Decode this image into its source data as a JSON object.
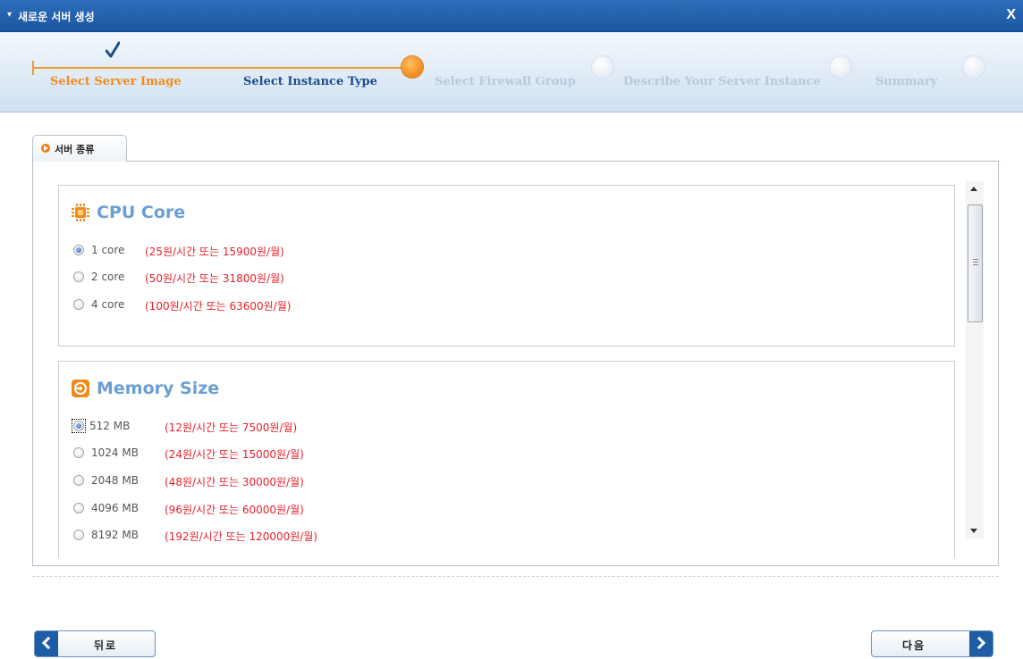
{
  "window": {
    "title": "새로운 서버 생성",
    "close_label": "X",
    "collapse_glyph": "▾"
  },
  "wizard": {
    "steps": [
      {
        "label": "Select Server Image",
        "state": "done"
      },
      {
        "label": "Select Instance Type",
        "state": "current"
      },
      {
        "label": "Select Firewall Group",
        "state": "future"
      },
      {
        "label": "Describe Your Server Instance",
        "state": "future"
      },
      {
        "label": "Summary",
        "state": "future"
      }
    ],
    "colors": {
      "done": "#f28a1a",
      "current": "#1d4e8a",
      "future": "#b8c9dc"
    }
  },
  "tab": {
    "label": "서버 종류"
  },
  "cpu": {
    "title": "CPU Core",
    "icon": "cpu-chip-icon",
    "options": [
      {
        "label": "1 core",
        "price": "(25원/시간 또는 15900원/월)",
        "selected": true
      },
      {
        "label": "2 core",
        "price": "(50원/시간 또는 31800원/월)",
        "selected": false
      },
      {
        "label": "4 core",
        "price": "(100원/시간 또는 63600원/월)",
        "selected": false
      }
    ]
  },
  "memory": {
    "title": "Memory Size",
    "icon": "memory-disk-icon",
    "options": [
      {
        "label": "512 MB",
        "price": "(12원/시간 또는 7500원/월)",
        "selected": true
      },
      {
        "label": "1024 MB",
        "price": "(24원/시간 또는 15000원/월)",
        "selected": false
      },
      {
        "label": "2048 MB",
        "price": "(48원/시간 또는 30000원/월)",
        "selected": false
      },
      {
        "label": "4096 MB",
        "price": "(96원/시간 또는 60000원/월)",
        "selected": false
      },
      {
        "label": "8192 MB",
        "price": "(192원/시간 또는 120000원/월)",
        "selected": false
      }
    ]
  },
  "buttons": {
    "back": "뒤로",
    "next": "다음"
  },
  "accent_colors": {
    "title_bar": "#1c55a0",
    "orange": "#f29a2c",
    "price_red": "#e8212a"
  }
}
